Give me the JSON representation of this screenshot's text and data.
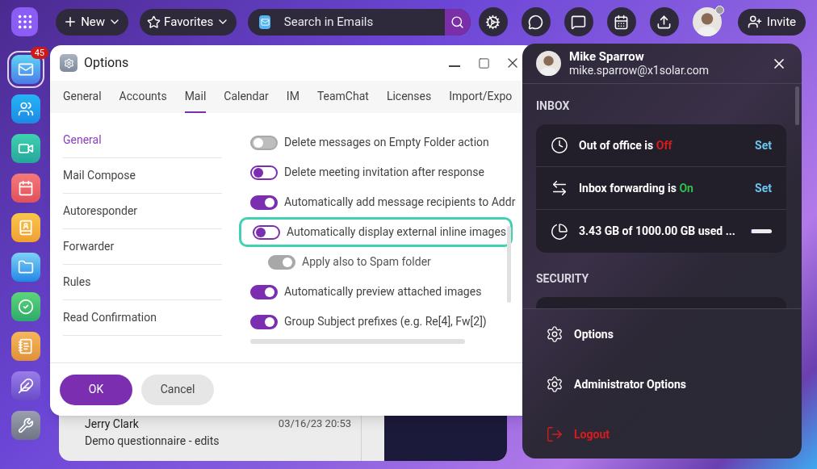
{
  "topbar": {
    "new_label": "New",
    "favorites_label": "Favorites",
    "search_placeholder": "Search in Emails",
    "invite_label": "Invite"
  },
  "rail": [
    {
      "kind": "mail",
      "selected": true,
      "badge": "45"
    },
    {
      "kind": "contacts",
      "selected": false
    },
    {
      "kind": "video",
      "selected": false
    },
    {
      "kind": "calendar",
      "selected": false
    },
    {
      "kind": "addressbook",
      "selected": false
    },
    {
      "kind": "files",
      "selected": false
    },
    {
      "kind": "tasks",
      "selected": false
    },
    {
      "kind": "notes",
      "selected": false
    },
    {
      "kind": "wings",
      "selected": false
    },
    {
      "kind": "tools",
      "selected": false
    }
  ],
  "mail_list": {
    "sender": "Jerry Clark",
    "date": "03/16/23 20:53",
    "subject": "Demo questionnaire - edits"
  },
  "dialog": {
    "title": "Options",
    "tabs": [
      {
        "label": "General",
        "selected": false
      },
      {
        "label": "Accounts",
        "selected": false
      },
      {
        "label": "Mail",
        "selected": true
      },
      {
        "label": "Calendar",
        "selected": false
      },
      {
        "label": "IM",
        "selected": false
      },
      {
        "label": "TeamChat",
        "selected": false
      },
      {
        "label": "Licenses",
        "selected": false
      },
      {
        "label": "Import/Expo",
        "selected": false
      }
    ],
    "sections": [
      {
        "label": "General",
        "selected": true
      },
      {
        "label": "Mail Compose",
        "selected": false
      },
      {
        "label": "Autoresponder",
        "selected": false
      },
      {
        "label": "Forwarder",
        "selected": false
      },
      {
        "label": "Rules",
        "selected": false
      },
      {
        "label": "Read Confirmation",
        "selected": false
      }
    ],
    "settings": [
      {
        "label": "Delete messages on Empty Folder action",
        "on": false,
        "disabled": true,
        "highlighted": false,
        "indented": false
      },
      {
        "label": "Delete meeting invitation after response",
        "on": false,
        "disabled": false,
        "highlighted": false,
        "indented": false
      },
      {
        "label": "Automatically add message recipients to Addr",
        "on": true,
        "disabled": false,
        "highlighted": false,
        "indented": false
      },
      {
        "label": "Automatically display external inline images",
        "on": false,
        "disabled": false,
        "highlighted": true,
        "indented": false
      },
      {
        "label": "Apply also to Spam folder",
        "on": true,
        "disabled": true,
        "highlighted": false,
        "indented": true
      },
      {
        "label": "Automatically preview attached images",
        "on": true,
        "disabled": false,
        "highlighted": false,
        "indented": false
      },
      {
        "label": "Group Subject prefixes (e.g. Re[4], Fw[2])",
        "on": true,
        "disabled": false,
        "highlighted": false,
        "indented": false
      }
    ],
    "buttons": [
      {
        "label": "OK",
        "kind": "primary"
      },
      {
        "label": "Cancel",
        "kind": "secondary"
      }
    ]
  },
  "account_panel": {
    "name": "Mike Sparrow",
    "email": "mike.sparrow@x1solar.com",
    "inbox_heading": "INBOX",
    "inbox_rows": [
      {
        "kind": "autoreply",
        "label": "Out of office is",
        "status": "Off",
        "on": false,
        "action": "Set"
      },
      {
        "kind": "forwarding",
        "label": "Inbox forwarding is",
        "status": "On",
        "on": true,
        "action": "Set"
      },
      {
        "kind": "storage",
        "label": "3.43 GB of 1000.00 GB used ...",
        "level": 0.0034
      }
    ],
    "security_heading": "SECURITY",
    "menu": [
      {
        "kind": "settings",
        "label": "Options"
      },
      {
        "kind": "settings",
        "label": "Administrator Options"
      },
      {
        "kind": "logout",
        "label": "Logout"
      }
    ]
  }
}
